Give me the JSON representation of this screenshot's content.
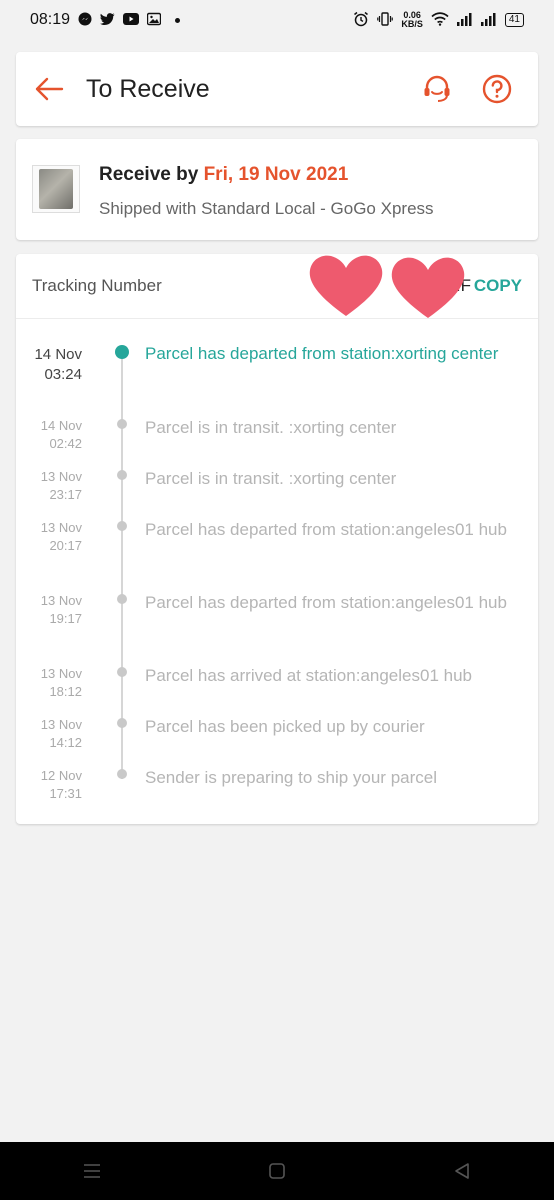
{
  "status_bar": {
    "time": "08:19",
    "notification_icons": [
      "messenger-icon",
      "twitter-icon",
      "youtube-icon",
      "gallery-icon"
    ],
    "speed_value": "0.06",
    "speed_unit": "KB/S",
    "battery": "41"
  },
  "header": {
    "title": "To Receive",
    "accent_color": "#e5532d"
  },
  "receive": {
    "prefix": "Receive by",
    "date": "Fri, 19 Nov 2021",
    "shipping": "Shipped with Standard Local - GoGo Xpress"
  },
  "tracking": {
    "label": "Tracking Number",
    "number_visible": "0 ZF",
    "copy_label": "COPY",
    "accent_color": "#26a69a"
  },
  "events": [
    {
      "date": "14 Nov",
      "time": "03:24",
      "text": "Parcel has departed from station:xorting center",
      "active": true
    },
    {
      "date": "14 Nov",
      "time": "02:42",
      "text": "Parcel is in transit. :xorting center",
      "active": false
    },
    {
      "date": "13 Nov",
      "time": "23:17",
      "text": "Parcel is in transit. :xorting center",
      "active": false
    },
    {
      "date": "13 Nov",
      "time": "20:17",
      "text": "Parcel has departed from station:angeles01 hub",
      "active": false
    },
    {
      "date": "13 Nov",
      "time": "19:17",
      "text": "Parcel has departed from station:angeles01 hub",
      "active": false
    },
    {
      "date": "13 Nov",
      "time": "18:12",
      "text": "Parcel has arrived at station:angeles01 hub",
      "active": false
    },
    {
      "date": "13 Nov",
      "time": "14:12",
      "text": "Parcel has been picked up by courier",
      "active": false
    },
    {
      "date": "12 Nov",
      "time": "17:31",
      "text": "Sender is preparing to ship your parcel",
      "active": false
    }
  ]
}
